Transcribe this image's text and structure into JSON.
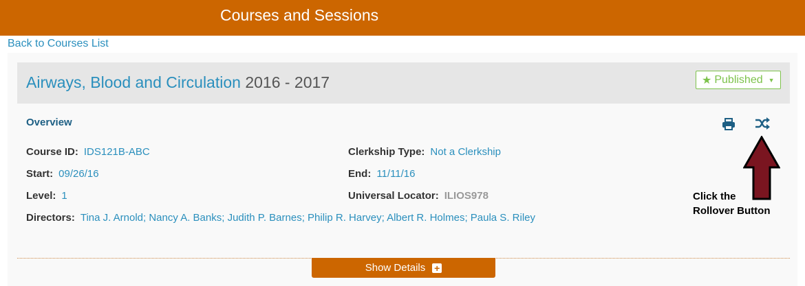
{
  "header": {
    "title": "Courses and Sessions"
  },
  "nav": {
    "back_link": "Back to Courses List"
  },
  "course": {
    "name": "Airways, Blood and Circulation",
    "year": "2016 - 2017",
    "status": "Published"
  },
  "overview": {
    "title": "Overview",
    "course_id_label": "Course ID:",
    "course_id": "IDS121B-ABC",
    "clerkship_label": "Clerkship Type:",
    "clerkship": "Not a Clerkship",
    "start_label": "Start:",
    "start": "09/26/16",
    "end_label": "End:",
    "end": "11/11/16",
    "level_label": "Level:",
    "level": "1",
    "locator_label": "Universal Locator:",
    "locator": "ILIOS978",
    "directors_label": "Directors:",
    "directors": "Tina J. Arnold; Nancy A. Banks; Judith P. Barnes; Philip R. Harvey; Albert R. Holmes; Paula S. Riley"
  },
  "show_details": "Show Details",
  "annotation": {
    "line1": "Click the",
    "line2": "Rollover Button"
  },
  "colors": {
    "brand": "#cc6600",
    "link": "#2a8fbd",
    "published": "#7dc24b",
    "arrow": "#7a1520"
  },
  "icons": {
    "print": "print-icon",
    "rollover": "shuffle-icon",
    "star": "star-icon",
    "plus": "plus-icon"
  }
}
